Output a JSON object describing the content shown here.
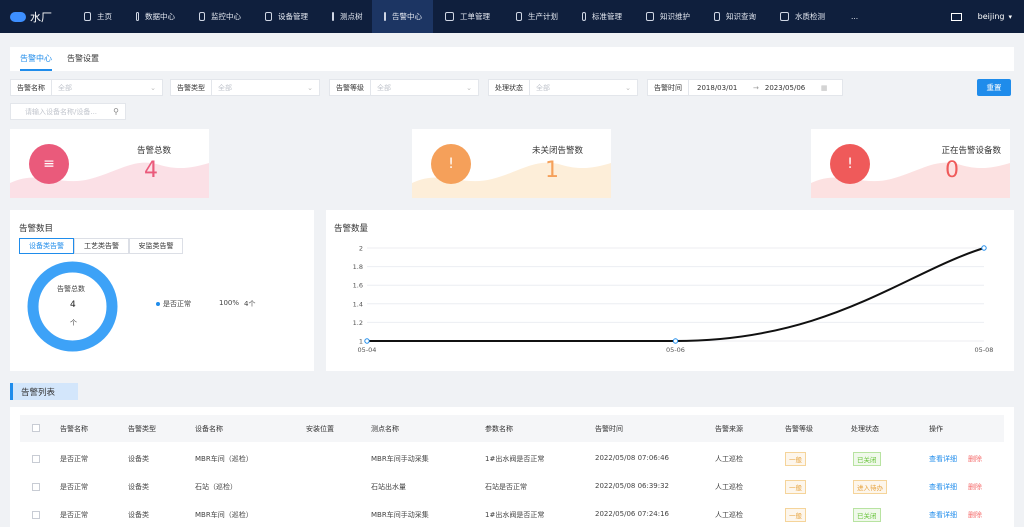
{
  "app": {
    "title": "水厂"
  },
  "nav": {
    "items": [
      {
        "label": "主页"
      },
      {
        "label": "数据中心"
      },
      {
        "label": "监控中心"
      },
      {
        "label": "设备管理"
      },
      {
        "label": "测点树"
      },
      {
        "label": "告警中心"
      },
      {
        "label": "工单管理"
      },
      {
        "label": "生产计划"
      },
      {
        "label": "标准管理"
      },
      {
        "label": "知识维护"
      },
      {
        "label": "知识查询"
      },
      {
        "label": "水质检测"
      },
      {
        "label": "..."
      }
    ],
    "active_index": 5,
    "user": "beijing"
  },
  "tabs": {
    "items": [
      {
        "label": "告警中心"
      },
      {
        "label": "告警设置"
      }
    ]
  },
  "filters": {
    "name": {
      "label": "告警名称",
      "placeholder": "全部"
    },
    "type": {
      "label": "告警类型",
      "placeholder": "全部"
    },
    "level": {
      "label": "告警等级",
      "placeholder": "全部"
    },
    "status": {
      "label": "处理状态",
      "placeholder": "全部"
    },
    "time": {
      "label": "告警时间",
      "start": "2018/03/01",
      "arrow": "→",
      "end": "2023/05/06"
    },
    "reset_label": "重置",
    "search_placeholder": "请输入设备名称/设备..."
  },
  "stats": [
    {
      "title": "告警总数",
      "value": "4",
      "color": "#ea5a7b"
    },
    {
      "title": "未关闭告警数",
      "value": "1",
      "color": "#f5a05a"
    },
    {
      "title": "正在告警设备数",
      "value": "0",
      "color": "#ef5a5a"
    }
  ],
  "alarm_items": {
    "title": "告警数目",
    "tabs": [
      {
        "label": "设备类告警"
      },
      {
        "label": "工艺类告警"
      },
      {
        "label": "安监类告警"
      }
    ],
    "donut": {
      "label": "告警总数",
      "value": "4",
      "unit": "个"
    },
    "legend": {
      "name": "是否正常",
      "percent": "100%",
      "count": "4个"
    }
  },
  "chart_data": {
    "type": "line",
    "title": "告警数量",
    "x": [
      "05-04",
      "05-06",
      "05-08"
    ],
    "series": [
      {
        "values": [
          1,
          1,
          2
        ]
      }
    ],
    "ylim": [
      1,
      2
    ],
    "yticks": [
      "1",
      "1.2",
      "1.4",
      "1.6",
      "1.8",
      "2"
    ],
    "grid": true
  },
  "list": {
    "title": "告警列表",
    "columns": [
      "告警名称",
      "告警类型",
      "设备名称",
      "安装位置",
      "测点名称",
      "参数名称",
      "告警时间",
      "告警来源",
      "告警等级",
      "处理状态",
      "操作"
    ],
    "rows": [
      {
        "name": "是否正常",
        "type": "设备类",
        "device": "MBR车间（巡检）",
        "location": "",
        "point": "MBR车间手动采集",
        "param": "1#出水阀是否正常",
        "time": "2022/05/08 07:06:46",
        "source": "人工巡检",
        "level": "一般",
        "status": "已关闭",
        "status_kind": "closed"
      },
      {
        "name": "是否正常",
        "type": "设备类",
        "device": "石站（巡检）",
        "location": "",
        "point": "石站出水量",
        "param": "石站是否正常",
        "time": "2022/05/08 06:39:32",
        "source": "人工巡检",
        "level": "一般",
        "status": "进入待办",
        "status_kind": "proc"
      },
      {
        "name": "是否正常",
        "type": "设备类",
        "device": "MBR车间（巡检）",
        "location": "",
        "point": "MBR车间手动采集",
        "param": "1#出水阀是否正常",
        "time": "2022/05/06 07:24:16",
        "source": "人工巡检",
        "level": "一般",
        "status": "已关闭",
        "status_kind": "closed"
      }
    ],
    "actions": {
      "detail": "查看详细",
      "delete": "删除"
    }
  }
}
